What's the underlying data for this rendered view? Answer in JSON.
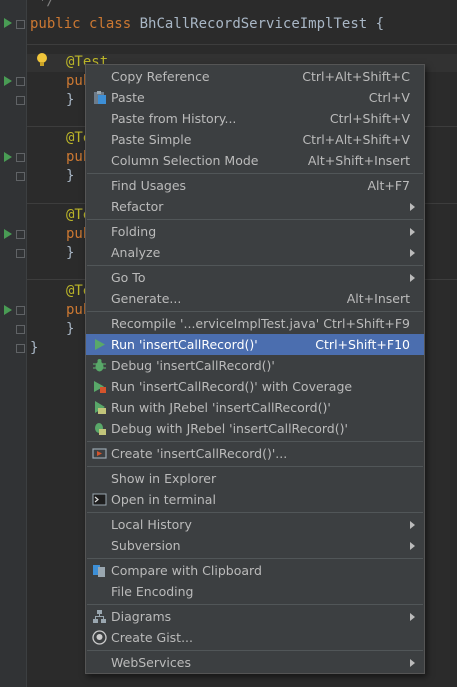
{
  "editor": {
    "lines": {
      "comment_end": " */",
      "class_kw1": "public",
      "class_kw2": "class",
      "class_name": "BhCallRecordServiceImplTest",
      "brace_open": "{",
      "ann1": "@Test",
      "pub": "pub",
      "close": "}",
      "ann_partial": "@Te",
      "class_close": "}"
    }
  },
  "menu": {
    "items": [
      {
        "label": "Copy Reference",
        "shortcut": "Ctrl+Alt+Shift+C"
      },
      {
        "label": "Paste",
        "shortcut": "Ctrl+V",
        "icon": "clipboard-icon"
      },
      {
        "label": "Paste from History...",
        "shortcut": "Ctrl+Shift+V"
      },
      {
        "label": "Paste Simple",
        "shortcut": "Ctrl+Alt+Shift+V"
      },
      {
        "label": "Column Selection Mode",
        "shortcut": "Alt+Shift+Insert"
      },
      {
        "label": "Find Usages",
        "shortcut": "Alt+F7"
      },
      {
        "label": "Refactor",
        "shortcut": ""
      },
      {
        "label": "Folding",
        "shortcut": ""
      },
      {
        "label": "Analyze",
        "shortcut": ""
      },
      {
        "label": "Go To",
        "shortcut": ""
      },
      {
        "label": "Generate...",
        "shortcut": "Alt+Insert"
      },
      {
        "label": "Recompile '...erviceImplTest.java'",
        "shortcut": "Ctrl+Shift+F9"
      },
      {
        "label": "Run 'insertCallRecord()'",
        "shortcut": "Ctrl+Shift+F10",
        "icon": "run-icon"
      },
      {
        "label": "Debug 'insertCallRecord()'",
        "shortcut": "",
        "icon": "debug-icon"
      },
      {
        "label": "Run 'insertCallRecord()' with Coverage",
        "shortcut": "",
        "icon": "coverage-icon"
      },
      {
        "label": "Run with JRebel 'insertCallRecord()'",
        "shortcut": "",
        "icon": "jrebel-run-icon"
      },
      {
        "label": "Debug with JRebel 'insertCallRecord()'",
        "shortcut": "",
        "icon": "jrebel-debug-icon"
      },
      {
        "label": "Create 'insertCallRecord()'...",
        "shortcut": "",
        "icon": "create-config-icon"
      },
      {
        "label": "Show in Explorer",
        "shortcut": ""
      },
      {
        "label": "Open in terminal",
        "shortcut": "",
        "icon": "terminal-icon"
      },
      {
        "label": "Local History",
        "shortcut": ""
      },
      {
        "label": "Subversion",
        "shortcut": ""
      },
      {
        "label": "Compare with Clipboard",
        "shortcut": "",
        "icon": "compare-icon"
      },
      {
        "label": "File Encoding",
        "shortcut": ""
      },
      {
        "label": "Diagrams",
        "shortcut": "",
        "icon": "diagram-icon"
      },
      {
        "label": "Create Gist...",
        "shortcut": "",
        "icon": "github-icon"
      },
      {
        "label": "WebServices",
        "shortcut": ""
      }
    ]
  },
  "colors": {
    "background": "#2b2b2b",
    "menu_bg": "#3c3f41",
    "selection": "#4b6eaf",
    "keyword": "#cc7832",
    "annotation": "#bbb529"
  }
}
